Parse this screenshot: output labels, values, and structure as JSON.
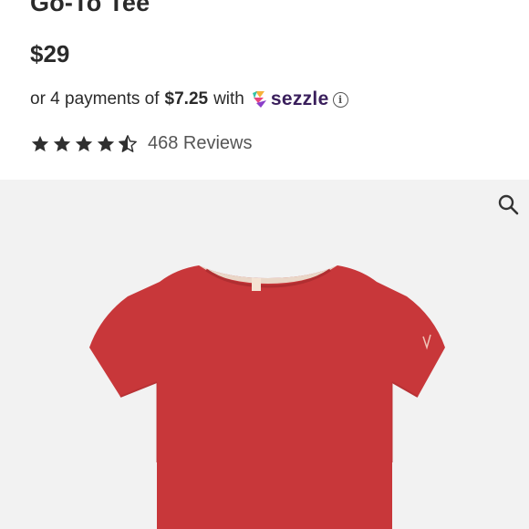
{
  "product": {
    "title": "Go-To Tee",
    "price": "$29"
  },
  "payment": {
    "prefix": "or 4 payments of",
    "amount": "$7.25",
    "middle": "with",
    "provider": "sezzle",
    "provider_icon": "sezzle-logo-icon",
    "info_icon": "info-icon"
  },
  "rating": {
    "stars": 4.5,
    "max_stars": 5,
    "reviews_label": "468 Reviews"
  },
  "image": {
    "zoom_icon": "magnifier-icon",
    "background_color": "#f2f2f2",
    "shirt_color": "#c8373a"
  }
}
